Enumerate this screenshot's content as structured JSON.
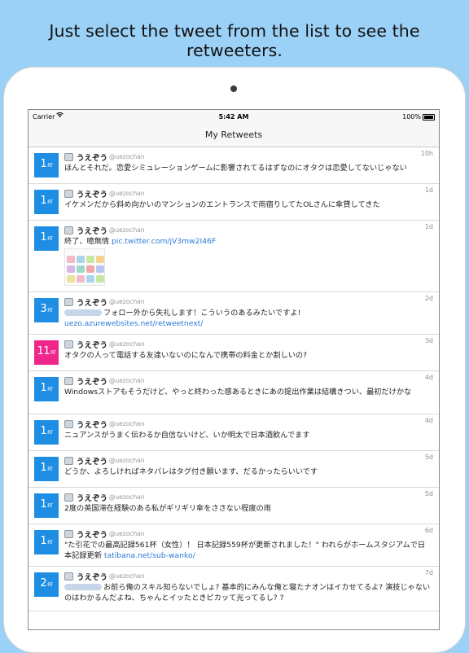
{
  "caption": "Just select the tweet from the list to see the retweeters.",
  "status_bar": {
    "carrier": "Carrier",
    "time": "5:42 AM",
    "battery": "100%"
  },
  "nav": {
    "title": "My Retweets"
  },
  "user": {
    "name": "うえぞう",
    "handle": "@uezochan"
  },
  "colors": {
    "blue_badge": "#1d8ee3",
    "pink_badge": "#f0268d",
    "link": "#2a7ad6",
    "background": "#9cd1f7"
  },
  "rt_suffix": "RT",
  "tweets": [
    {
      "rt": "1",
      "when": "10h",
      "text": "ほんとそれだ。恋愛シミュレーションゲームに影響されてるはずなのにオタクは恋愛してないじゃない"
    },
    {
      "rt": "1",
      "when": "1d",
      "text": "イケメンだから斜め向かいのマンションのエントランスで雨宿りしてたOLさんに傘貸してきた"
    },
    {
      "rt": "1",
      "when": "1d",
      "text": "終了、噫無情 ",
      "link": "pic.twitter.com/jV3mw2I46F"
    },
    {
      "rt": "3",
      "when": "2d",
      "text": "フォロー外から失礼します！こういうのあるみたいですよ!",
      "link": "uezo.azurewebsites.net/retweetnext/"
    },
    {
      "rt": "11",
      "when": "3d",
      "text": "オタクの人って電話する友達いないのになんで携帯の料金とか割しいの?"
    },
    {
      "rt": "1",
      "when": "4d",
      "text": "Windowsストアもそうだけど、やっと終わった感あるときにあの提出作業は結構きつい、最初だけかな"
    },
    {
      "rt": "1",
      "when": "4d",
      "text": "ニュアンスがうまく伝わるか自信ないけど、いか明太で日本酒飲んでます"
    },
    {
      "rt": "1",
      "when": "5d",
      "text": "どうか、よろしければネタバレはタグ付き願います、だるかったらいいです"
    },
    {
      "rt": "1",
      "when": "5d",
      "text": "2度の英国滞在経験のある私がギリギリ傘をささない程度の雨"
    },
    {
      "rt": "1",
      "when": "6d",
      "text": "\"た引花での最高記録561杯（女性）！ 日本記録559杯が更新されました！\" われらがホームスタジアムで日本記録更新 ",
      "link": "tatibana.net/sub-wanko/"
    },
    {
      "rt": "2",
      "when": "7d",
      "text": "お前ら俺のスキル知らないでしょ? 基本的にみんな俺と寝たナオンはイカせてるよ? 演技じゃないのはわかるんだよね、ちゃんとイッたときピカッて光ってるし? ?"
    }
  ]
}
